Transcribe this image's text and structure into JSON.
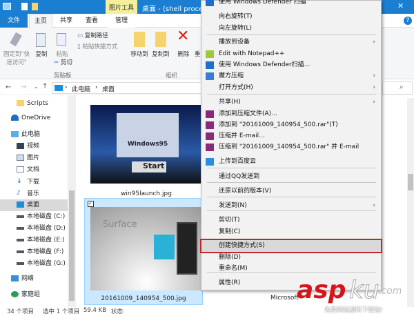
{
  "window": {
    "title": "桌面 - (shell process:",
    "context_tab": "图片工具",
    "close": "✕",
    "help": "?"
  },
  "ribbon_tabs": [
    "文件",
    "主页",
    "共享",
    "查看",
    "管理"
  ],
  "ribbon": {
    "pin": "固定到\"快速访问\"",
    "copy": "复制",
    "paste": "粘贴",
    "copy_path": "复制路径",
    "paste_shortcut": "粘贴快捷方式",
    "cut": "剪切",
    "clipboard_group": "剪贴板",
    "move_to": "移动到",
    "copy_to": "复制到",
    "delete": "删除",
    "rename": "重",
    "organize_group": "组织"
  },
  "address": {
    "crumbs": [
      "此电脑",
      "桌面"
    ]
  },
  "nav": [
    {
      "label": "Scripts",
      "icon": "folder-icon"
    },
    {
      "label": "OneDrive",
      "icon": "cloud-icon"
    },
    {
      "label": "此电脑",
      "icon": "pc-icon"
    },
    {
      "label": "视频",
      "icon": "video-icon"
    },
    {
      "label": "图片",
      "icon": "picture-icon"
    },
    {
      "label": "文档",
      "icon": "document-icon"
    },
    {
      "label": "下载",
      "icon": "download-icon"
    },
    {
      "label": "音乐",
      "icon": "music-icon"
    },
    {
      "label": "桌面",
      "icon": "desktop-icon"
    },
    {
      "label": "本地磁盘 (C:)",
      "icon": "drive-icon"
    },
    {
      "label": "本地磁盘 (D:)",
      "icon": "drive-icon"
    },
    {
      "label": "本地磁盘 (E:)",
      "icon": "drive-icon"
    },
    {
      "label": "本地磁盘 (F:)",
      "icon": "drive-icon"
    },
    {
      "label": "本地磁盘 (G:)",
      "icon": "drive-icon"
    },
    {
      "label": "网络",
      "icon": "network-icon"
    },
    {
      "label": "家庭组",
      "icon": "homegroup-icon"
    }
  ],
  "files": [
    {
      "name": "win95launch.jpg"
    },
    {
      "name": "20161009_140954_500.jpg"
    },
    {
      "name": "Microsoft"
    }
  ],
  "thumb_text": {
    "win95": "Windows95",
    "start": "Start",
    "surface": "Surface"
  },
  "status": {
    "count": "34 个项目",
    "selected": "选中 1 个项目",
    "size": "59.4 KB",
    "state": "状态:"
  },
  "menu": [
    {
      "label": "使用 Windows Defender 扫描",
      "icon": "defender-icon"
    },
    {
      "label": "向右旋转(T)"
    },
    {
      "label": "向左旋转(L)"
    },
    {
      "label": "播放到设备",
      "sub": true
    },
    {
      "label": "Edit with Notepad++",
      "icon": "notepad-icon"
    },
    {
      "label": "使用 Windows Defender扫描...",
      "icon": "defender-icon"
    },
    {
      "label": "魔方压缩",
      "icon": "cube-icon",
      "sub": true
    },
    {
      "label": "打开方式(H)",
      "sub": true
    },
    {
      "label": "共享(H)",
      "sub": true
    },
    {
      "label": "添加到压缩文件(A)...",
      "icon": "winrar-icon"
    },
    {
      "label": "添加到 \"20161009_140954_500.rar\"(T)",
      "icon": "winrar-icon"
    },
    {
      "label": "压缩并 E-mail...",
      "icon": "winrar-icon"
    },
    {
      "label": "压缩到 \"20161009_140954_500.rar\" 并 E-mail",
      "icon": "winrar-icon"
    },
    {
      "label": "上传到百度云",
      "icon": "baidu-cloud-icon"
    },
    {
      "label": "通过QQ发送到"
    },
    {
      "label": "还原以前的版本(V)"
    },
    {
      "label": "发送到(N)",
      "sub": true
    },
    {
      "label": "剪切(T)"
    },
    {
      "label": "复制(C)"
    },
    {
      "label": "创建快捷方式(S)",
      "highlighted": true
    },
    {
      "label": "删除(D)"
    },
    {
      "label": "重命名(M)"
    },
    {
      "label": "属性(R)"
    }
  ],
  "watermark": {
    "brand": "asp",
    "brand2": "ku",
    "suffix": ".com",
    "tagline": "免费网站源码下载站!"
  },
  "colors": {
    "titlebar": "#1a7fd1",
    "highlight_border": "#c0272d",
    "selection": "#cce8ff"
  }
}
